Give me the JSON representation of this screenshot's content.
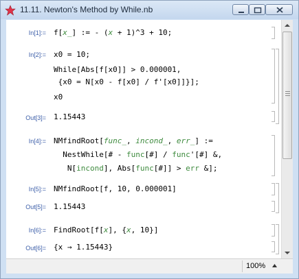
{
  "window": {
    "title": "11.11. Newton's Method by While.nb",
    "accent": "#cfe0f3"
  },
  "cells": [
    {
      "label": "In[1]:=",
      "lines": [
        "f[x_] := - (x + 1)^3 + 10;"
      ]
    },
    {
      "label": "In[2]:=",
      "lines": [
        "x0 = 10;",
        "While[Abs[f[x0]] > 0.000001,",
        " {x0 = N[x0 - f[x0] / f'[x0]]}];",
        "x0"
      ]
    },
    {
      "label": "Out[3]=",
      "lines": [
        "1.15443"
      ]
    },
    {
      "label": "In[4]:=",
      "lines": [
        "NMfindRoot[func_, incond_, err_] :=",
        "  NestWhile[# - func[#] / func'[#] &,",
        "   N[incond], Abs[func[#]] > err &];"
      ]
    },
    {
      "label": "In[5]:=",
      "lines": [
        "NMfindRoot[f, 10, 0.000001]"
      ]
    },
    {
      "label": "Out[5]=",
      "lines": [
        "1.15443"
      ]
    },
    {
      "label": "In[6]:=",
      "lines": [
        "FindRoot[f[x], {x, 10}]"
      ]
    },
    {
      "label": "Out[6]=",
      "lines": [
        "{x → 1.15443}"
      ]
    }
  ],
  "status": {
    "zoom": "100%"
  }
}
